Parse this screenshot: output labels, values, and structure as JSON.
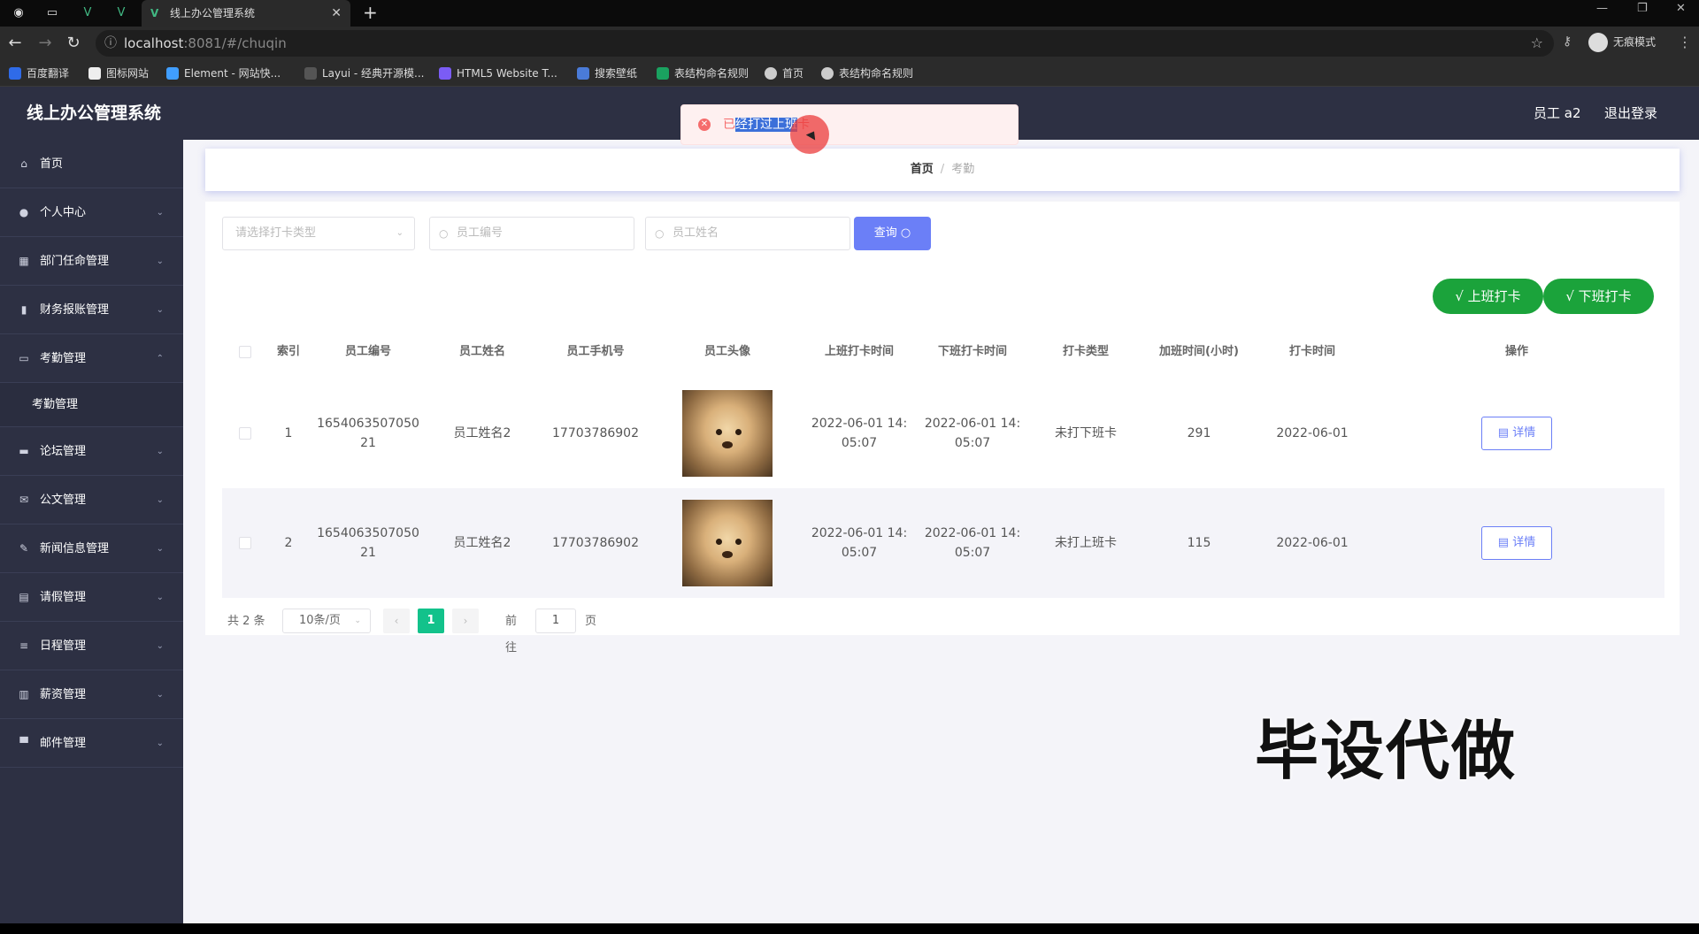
{
  "browser": {
    "tab_title": "线上办公管理系统",
    "url_host": "localhost",
    "url_rest": ":8081/#/chuqin",
    "incognito_label": "无痕模式",
    "bookmarks": [
      "百度翻译",
      "图标网站",
      "Element - 网站快...",
      "Layui - 经典开源模...",
      "HTML5 Website T...",
      "搜索壁纸",
      "表结构命名规则",
      "首页",
      "表结构命名规则"
    ]
  },
  "app": {
    "title": "线上办公管理系统",
    "user": "员工 a2",
    "logout": "退出登录"
  },
  "sidebar": {
    "items": [
      {
        "label": "首页",
        "icon": "home-icon"
      },
      {
        "label": "个人中心",
        "icon": "user-icon"
      },
      {
        "label": "部门任命管理",
        "icon": "grid-icon"
      },
      {
        "label": "财务报账管理",
        "icon": "bar-chart-icon"
      },
      {
        "label": "考勤管理",
        "icon": "chat-icon"
      },
      {
        "label": "论坛管理",
        "icon": "ticket-icon"
      },
      {
        "label": "公文管理",
        "icon": "mail-icon"
      },
      {
        "label": "新闻信息管理",
        "icon": "feather-icon"
      },
      {
        "label": "请假管理",
        "icon": "card-icon"
      },
      {
        "label": "日程管理",
        "icon": "list-icon"
      },
      {
        "label": "薪资管理",
        "icon": "wallet-icon"
      },
      {
        "label": "邮件管理",
        "icon": "monitor-icon"
      }
    ],
    "sub_item": "考勤管理"
  },
  "breadcrumb": {
    "home": "首页",
    "current": "考勤"
  },
  "filters": {
    "type_placeholder": "请选择打卡类型",
    "id_placeholder": "员工编号",
    "name_placeholder": "员工姓名",
    "query_label": "查询"
  },
  "actions": {
    "clock_in": "上班打卡",
    "clock_out": "下班打卡"
  },
  "table": {
    "headers": [
      "索引",
      "员工编号",
      "员工姓名",
      "员工手机号",
      "员工头像",
      "上班打卡时间",
      "下班打卡时间",
      "打卡类型",
      "加班时间(小时)",
      "打卡时间",
      "操作"
    ],
    "rows": [
      {
        "index": "1",
        "emp_id_1": "1654063507050",
        "emp_id_2": "21",
        "name": "员工姓名2",
        "phone": "17703786902",
        "in_1": "2022-06-01 14:",
        "in_2": "05:07",
        "out_1": "2022-06-01 14:",
        "out_2": "05:07",
        "type": "未打下班卡",
        "overtime": "291",
        "date": "2022-06-01",
        "detail": "详情"
      },
      {
        "index": "2",
        "emp_id_1": "1654063507050",
        "emp_id_2": "21",
        "name": "员工姓名2",
        "phone": "17703786902",
        "in_1": "2022-06-01 14:",
        "in_2": "05:07",
        "out_1": "2022-06-01 14:",
        "out_2": "05:07",
        "type": "未打上班卡",
        "overtime": "115",
        "date": "2022-06-01",
        "detail": "详情"
      }
    ]
  },
  "pagination": {
    "total": "共 2 条",
    "page_size": "10条/页",
    "current": "1",
    "goto": "前往",
    "goto_value": "1",
    "page_suffix": "页"
  },
  "toast": {
    "prefix": "已",
    "selected": "经打过上班",
    "suffix": "卡"
  },
  "watermark": "毕设代做",
  "colors": {
    "sidebar": "#2d3043",
    "primary": "#6b7ff7",
    "success": "#1ba33b",
    "pager_active": "#13c28b",
    "error": "#f56c6c"
  }
}
